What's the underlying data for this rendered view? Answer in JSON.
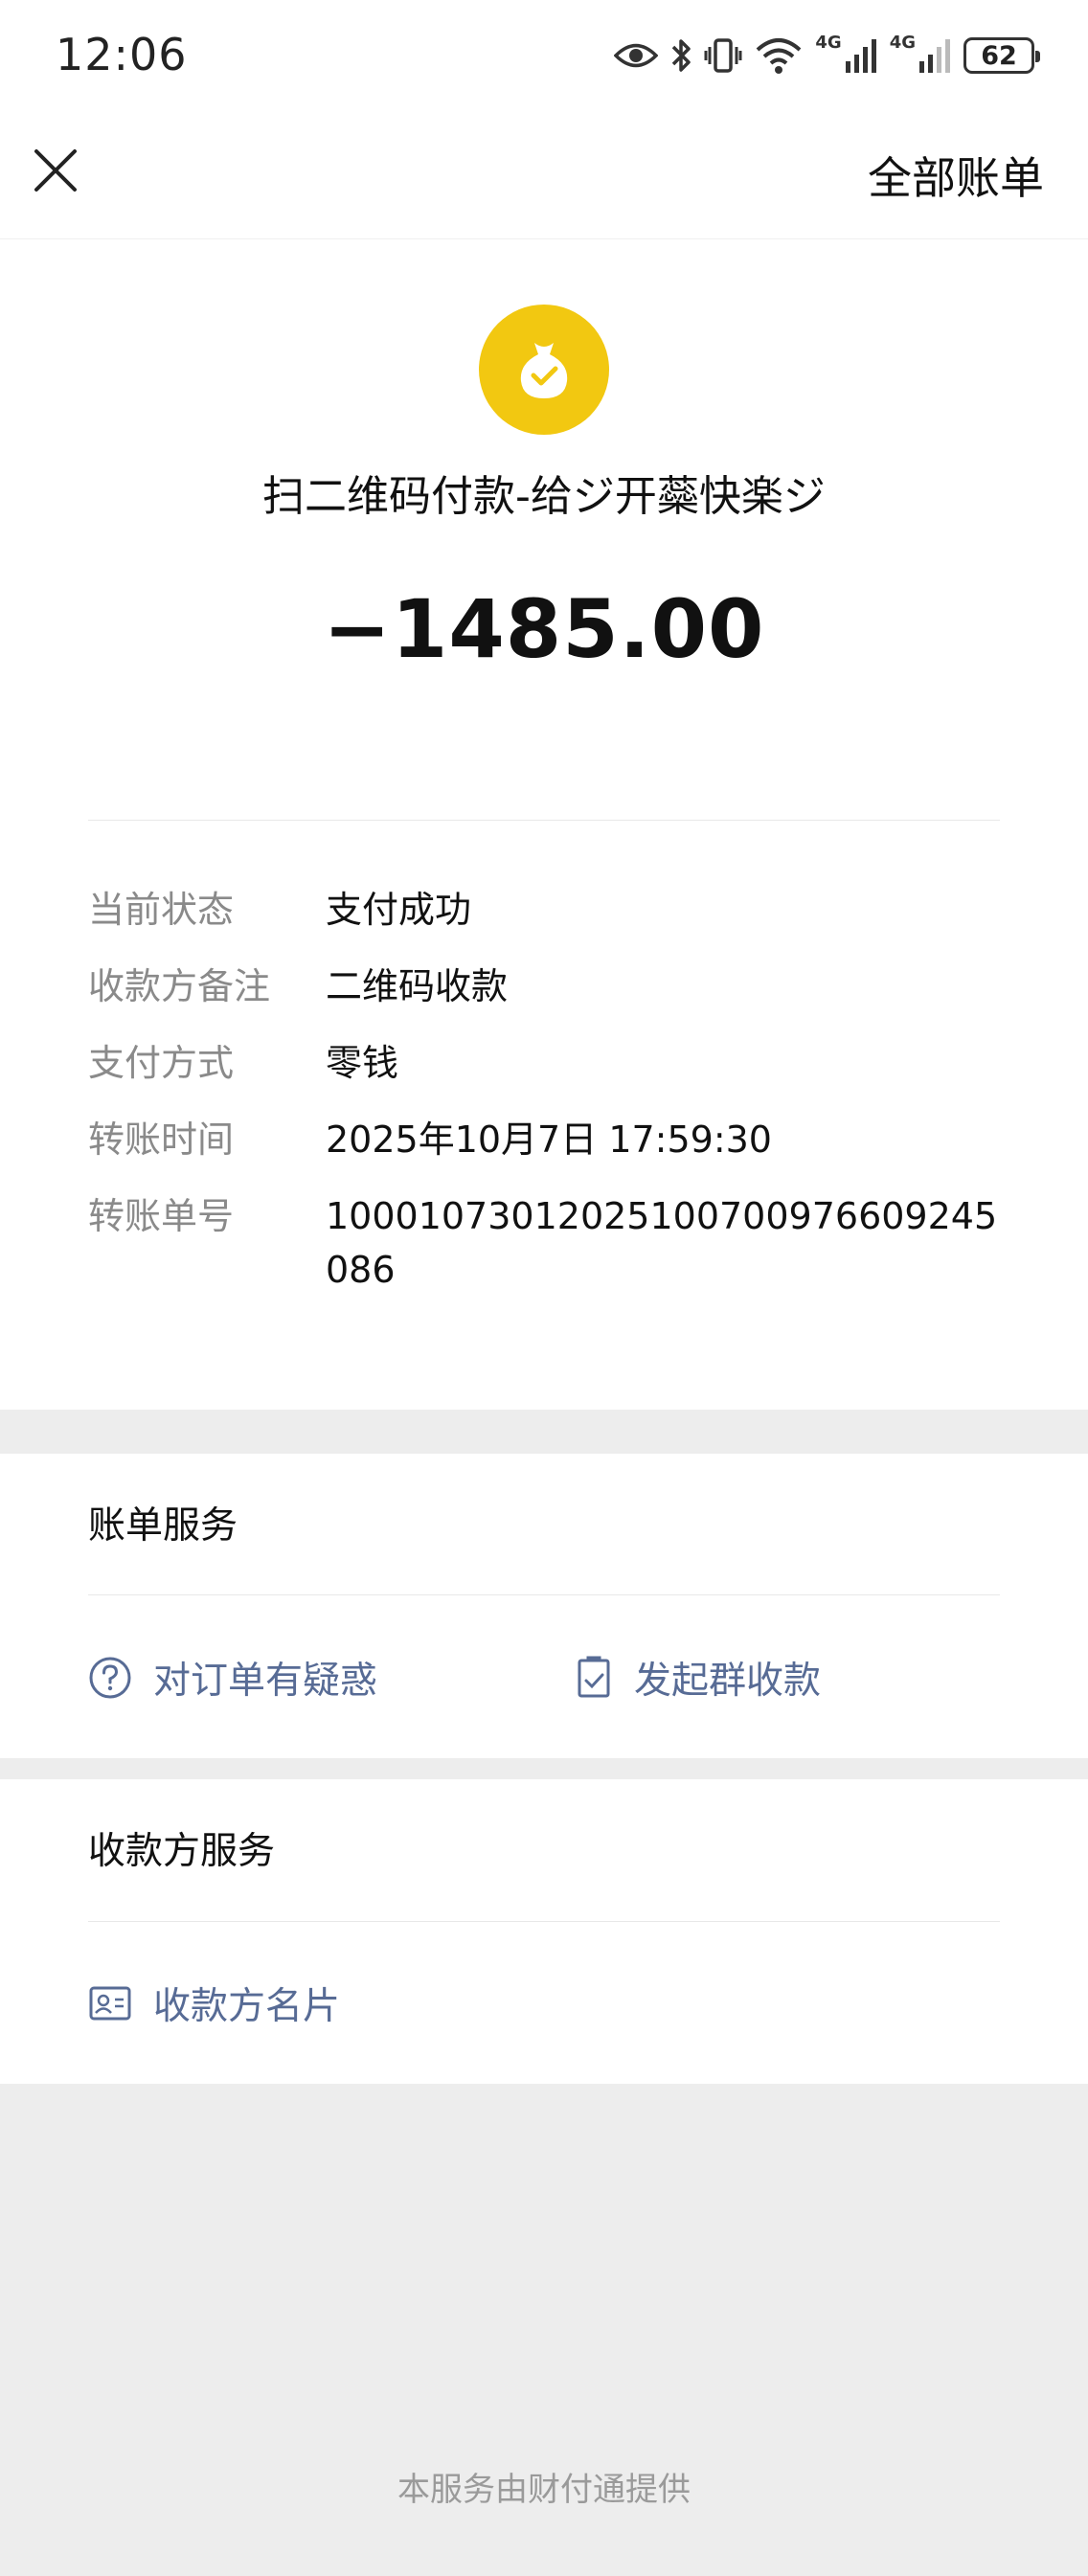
{
  "status_bar": {
    "time": "12:06",
    "battery": "62",
    "network_1": "4G",
    "network_2": "4G"
  },
  "nav": {
    "right_label": "全部账单"
  },
  "summary": {
    "icon": "money-bag-check-icon",
    "title": "扫二维码付款-给ジ开蘂快楽ジ",
    "amount": "−1485.00"
  },
  "details": [
    {
      "label": "当前状态",
      "value": "支付成功"
    },
    {
      "label": "收款方备注",
      "value": "二维码收款"
    },
    {
      "label": "支付方式",
      "value": "零钱"
    },
    {
      "label": "转账时间",
      "value": "2025年10月7日 17:59:30"
    },
    {
      "label": "转账单号",
      "value": "100010730120251007009766092450​86"
    }
  ],
  "bill_service": {
    "title": "账单服务",
    "links": [
      {
        "label": "对订单有疑惑",
        "icon": "question-circle-icon"
      },
      {
        "label": "发起群收款",
        "icon": "group-receipt-icon"
      }
    ]
  },
  "payee_service": {
    "title": "收款方服务",
    "links": [
      {
        "label": "收款方名片",
        "icon": "contact-card-icon"
      }
    ]
  },
  "footer": "本服务由财付通提供",
  "colors": {
    "accent": "#f2c811",
    "link": "#576b95",
    "background": "#ededed"
  }
}
